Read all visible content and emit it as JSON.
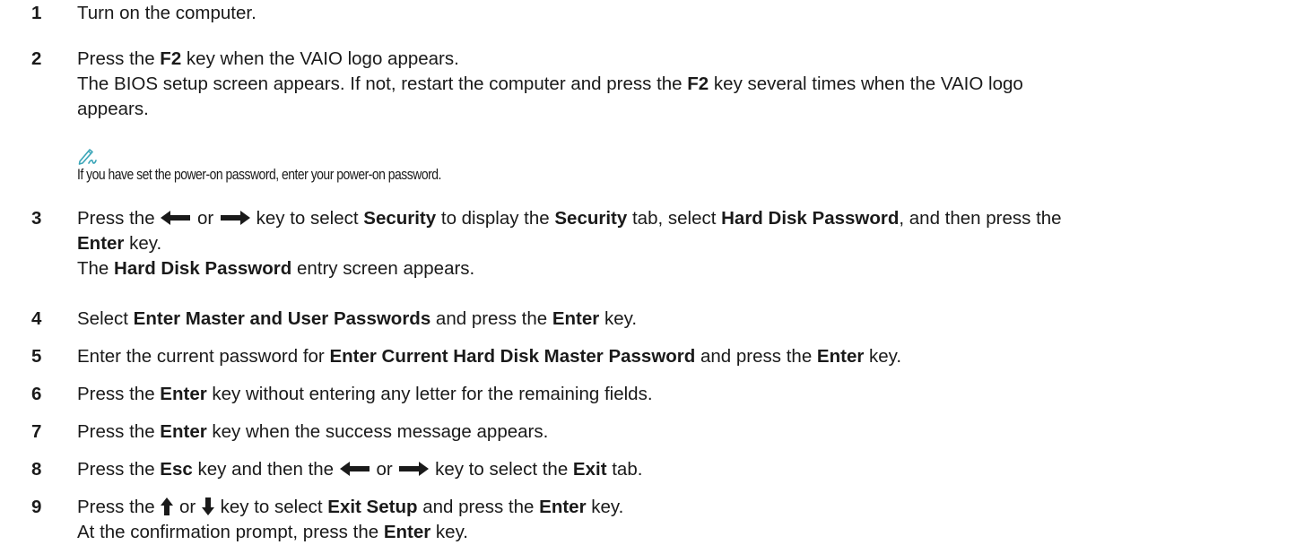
{
  "steps": [
    {
      "num": "1",
      "lines": [
        [
          "Turn on the computer."
        ]
      ]
    },
    {
      "num": "2",
      "lines": [
        [
          "Press the ",
          {
            "b": "F2"
          },
          " key when the VAIO logo appears."
        ],
        [
          "The BIOS setup screen appears. If not, restart the computer and press the ",
          {
            "b": "F2"
          },
          " key several times when the VAIO logo"
        ],
        [
          "appears."
        ]
      ]
    },
    {
      "num": "3",
      "lines": [
        [
          "Press the ",
          {
            "icon": "left-arrow"
          },
          " or ",
          {
            "icon": "right-arrow"
          },
          " key to select ",
          {
            "b": "Security"
          },
          " to display the ",
          {
            "b": "Security"
          },
          " tab, select ",
          {
            "b": "Hard Disk Password"
          },
          ", and then press the"
        ],
        [
          {
            "b": "Enter"
          },
          " key."
        ],
        [
          "The ",
          {
            "b": "Hard Disk Password"
          },
          " entry screen appears."
        ]
      ]
    },
    {
      "num": "4",
      "lines": [
        [
          "Select ",
          {
            "b": "Enter Master and User Passwords"
          },
          " and press the ",
          {
            "b": "Enter"
          },
          " key."
        ]
      ]
    },
    {
      "num": "5",
      "lines": [
        [
          "Enter the current password for ",
          {
            "b": "Enter Current Hard Disk Master Password"
          },
          " and press the ",
          {
            "b": "Enter"
          },
          " key."
        ]
      ]
    },
    {
      "num": "6",
      "lines": [
        [
          "Press the ",
          {
            "b": "Enter"
          },
          " key without entering any letter for the remaining fields."
        ]
      ]
    },
    {
      "num": "7",
      "lines": [
        [
          "Press the ",
          {
            "b": "Enter"
          },
          " key when the success message appears."
        ]
      ]
    },
    {
      "num": "8",
      "lines": [
        [
          "Press the ",
          {
            "b": "Esc"
          },
          " key and then the ",
          {
            "icon": "left-arrow"
          },
          " or ",
          {
            "icon": "right-arrow"
          },
          " key to select the ",
          {
            "b": "Exit"
          },
          " tab."
        ]
      ]
    },
    {
      "num": "9",
      "lines": [
        [
          "Press the ",
          {
            "icon": "up-arrow"
          },
          " or ",
          {
            "icon": "down-arrow"
          },
          " key to select ",
          {
            "b": "Exit Setup"
          },
          " and press the ",
          {
            "b": "Enter"
          },
          " key."
        ],
        [
          "At the confirmation prompt, press the ",
          {
            "b": "Enter"
          },
          " key."
        ]
      ]
    }
  ],
  "note": {
    "icon": "note-pen-icon",
    "text": "If you have set the power-on password, enter your power-on password."
  },
  "colors": {
    "text": "#1a1a1a",
    "note_icon": "#3aa5b8"
  }
}
